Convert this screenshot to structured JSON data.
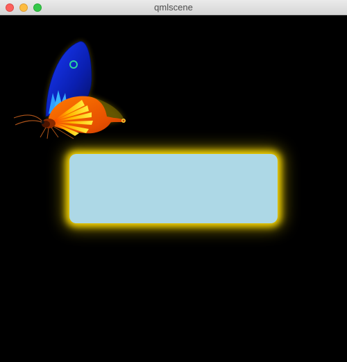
{
  "window": {
    "title": "qmlscene"
  },
  "colors": {
    "background": "#000000",
    "rect_fill": "#add8e6",
    "glow": "#ffdd00"
  },
  "icons": {
    "butterfly": "butterfly-icon"
  }
}
